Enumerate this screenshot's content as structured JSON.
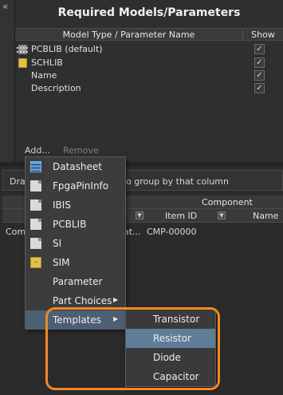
{
  "panel": {
    "title": "Required Models/Parameters",
    "col_name": "Model Type / Parameter Name",
    "col_show": "Show",
    "rows": [
      {
        "label": "PCBLIB (default)",
        "icon": "pcblib-icon",
        "show": true
      },
      {
        "label": "SCHLIB",
        "icon": "schlib-icon",
        "show": true
      },
      {
        "label": "Name",
        "show": true
      },
      {
        "label": "Description",
        "show": true
      }
    ],
    "add_label": "Add...",
    "remove_label": "Remove"
  },
  "lower": {
    "drag_text_left": "Dra",
    "drag_text_right": "o group by that column",
    "component_header": "Component",
    "item_id_header": "Item ID",
    "name_header": "Name",
    "row_comp": "Comp",
    "row_at": "at...",
    "row_cmp": "CMP-00000"
  },
  "menu": {
    "items": [
      {
        "label": "Datasheet",
        "icon": "table-icon"
      },
      {
        "label": "FpgaPinInfo",
        "icon": "document-icon"
      },
      {
        "label": "IBIS",
        "icon": "document-icon"
      },
      {
        "label": "PCBLIB",
        "icon": "document-icon"
      },
      {
        "label": "SI",
        "icon": "document-icon"
      },
      {
        "label": "SIM",
        "icon": "sim-icon"
      },
      {
        "label": "Parameter"
      },
      {
        "label": "Part Choices",
        "submenu": true
      },
      {
        "label": "Templates",
        "submenu": true,
        "active": true
      }
    ]
  },
  "submenu": {
    "items": [
      {
        "label": "Transistor"
      },
      {
        "label": "Resistor",
        "active": true
      },
      {
        "label": "Diode"
      },
      {
        "label": "Capacitor"
      }
    ]
  },
  "colors": {
    "highlight": "#f08a24",
    "menu_active": "#4d5f72",
    "submenu_active": "#5f7d99"
  }
}
